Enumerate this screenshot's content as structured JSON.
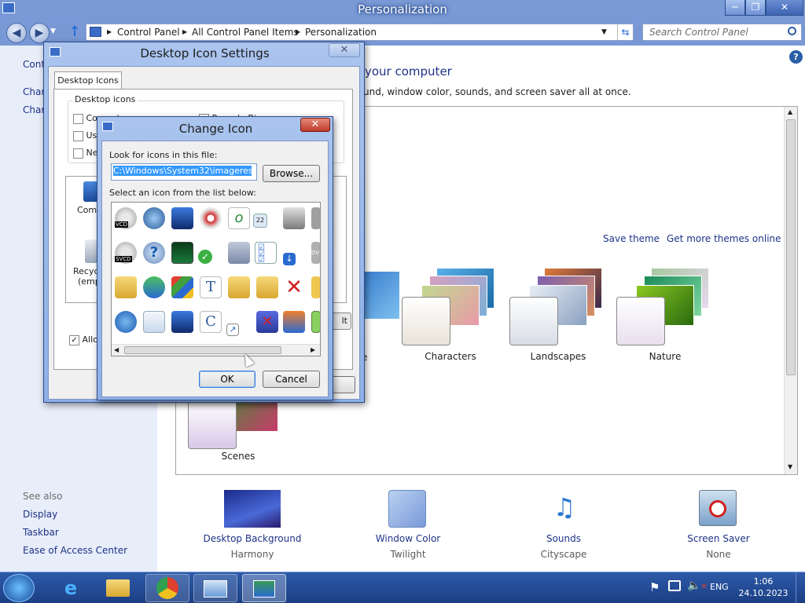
{
  "window": {
    "title": "Personalization",
    "minimize": "─",
    "restore": "❐",
    "close": "✕"
  },
  "nav": {
    "back": "◀",
    "forward": "▶",
    "up": "↑",
    "breadcrumb": [
      "Control Panel",
      "All Control Panel Items",
      "Personalization"
    ],
    "search_placeholder": "Search Control Panel"
  },
  "left_pane": {
    "partial_items": [
      "Cont",
      "Char",
      "Char"
    ],
    "see_also_label": "See also",
    "see_also": [
      "Display",
      "Taskbar",
      "Ease of Access Center"
    ]
  },
  "content": {
    "heading_partial": "your computer",
    "subtitle_partial": "und, window color, sounds, and screen saver all at once.",
    "save_theme": "Save theme",
    "get_more": "Get more themes online",
    "themes": [
      {
        "name": "e"
      },
      {
        "name": "Characters"
      },
      {
        "name": "Landscapes"
      },
      {
        "name": "Nature"
      },
      {
        "name": "Scenes"
      }
    ]
  },
  "bottom": [
    {
      "label": "Desktop Background",
      "value": "Harmony"
    },
    {
      "label": "Window Color",
      "value": "Twilight"
    },
    {
      "label": "Sounds",
      "value": "Cityscape"
    },
    {
      "label": "Screen Saver",
      "value": "None"
    }
  ],
  "desktop_icon_settings": {
    "title": "Desktop Icon Settings",
    "tab": "Desktop Icons",
    "group": "Desktop icons",
    "checks": [
      {
        "label": "Computer",
        "checked": false
      },
      {
        "label": "Use",
        "checked": false
      },
      {
        "label": "Net",
        "checked": false
      },
      {
        "label": "Recycle Bin",
        "checked": true
      }
    ],
    "icon_labels": [
      "Compu",
      "Recyc",
      "(emp"
    ],
    "allow_label": "Allow",
    "partial_button": "lt"
  },
  "change_icon": {
    "title": "Change Icon",
    "look_label": "Look for icons in this file:",
    "path": "C:\\Windows\\System32\\imageres.dll",
    "browse": "Browse...",
    "select_label": "Select an icon from the list below:",
    "ok": "OK",
    "cancel": "Cancel",
    "icon_text": {
      "vcd": "VCD",
      "svcd": "SVCD",
      "dv": "DV",
      "num": "22"
    }
  },
  "tray": {
    "lang": "ENG",
    "time": "1:06",
    "date": "24.10.2023"
  },
  "colors": {
    "link": "#1e3287",
    "title_bar": "#6d8fc4",
    "taskbar": "#1b3f84",
    "selection": "#3399ff"
  }
}
